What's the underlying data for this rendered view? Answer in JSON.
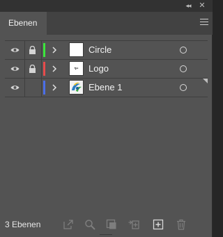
{
  "window": {
    "collapse_glyph": "◂◂",
    "close_glyph": "✕"
  },
  "tab": {
    "label": "Ebenen"
  },
  "layers": [
    {
      "name": "Circle",
      "visible": true,
      "locked": true,
      "color": "#3ce63c",
      "thumb": "blank"
    },
    {
      "name": "Logo",
      "visible": true,
      "locked": true,
      "color": "#e84c4c",
      "thumb": "logo-mark"
    },
    {
      "name": "Ebene 1",
      "visible": true,
      "locked": false,
      "color": "#4b6fe8",
      "thumb": "image",
      "selected": true
    }
  ],
  "footer": {
    "count_label": "3 Ebenen",
    "icons": [
      "export-icon",
      "locate-object-icon",
      "clipping-mask-icon",
      "collect-in-new-layer-icon",
      "new-layer-icon",
      "delete-icon"
    ]
  }
}
